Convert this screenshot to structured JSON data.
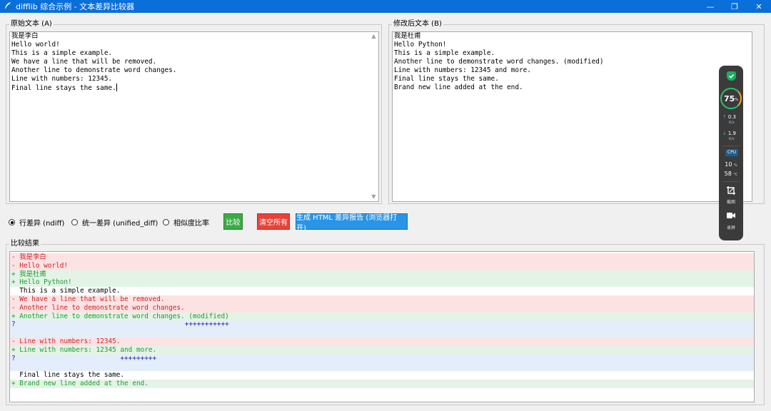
{
  "window": {
    "title": "difflib 综合示例 - 文本差异比较器",
    "app_icon": "feather-icon",
    "minimize_glyph": "—",
    "maximize_glyph": "❐",
    "close_glyph": "✕"
  },
  "panel_a": {
    "label": "原始文本 (A)",
    "lines": [
      "我是李白",
      "Hello world!",
      "This is a simple example.",
      "We have a line that will be removed.",
      "Another line to demonstrate word changes.",
      "Line with numbers: 12345.",
      "Final line stays the same."
    ]
  },
  "panel_b": {
    "label": "修改后文本 (B)",
    "lines": [
      "我是杜甫",
      "Hello Python!",
      "This is a simple example.",
      "Another line to demonstrate word changes. (modified)",
      "Line with numbers: 12345 and more.",
      "Final line stays the same.",
      "Brand new line added at the end."
    ]
  },
  "controls": {
    "radio_ndiff": "行差异 (ndiff)",
    "radio_unified": "统一差异 (unified_diff)",
    "radio_ratio": "相似度比率",
    "selected": "ndiff",
    "compare_button": "比较",
    "clear_button": "清空所有",
    "html_report_button": "生成 HTML 差异报告 (浏览器打开)"
  },
  "result": {
    "label": "比较结果",
    "lines": [
      {
        "text": "- 我是李白",
        "kind": "del"
      },
      {
        "text": "- Hello world!",
        "kind": "del"
      },
      {
        "text": "+ 我是杜甫",
        "kind": "add"
      },
      {
        "text": "+ Hello Python!",
        "kind": "add"
      },
      {
        "text": "  This is a simple example.",
        "kind": "plain"
      },
      {
        "text": "- We have a line that will be removed.",
        "kind": "del"
      },
      {
        "text": "- Another line to demonstrate word changes.",
        "kind": "del"
      },
      {
        "text": "+ Another line to demonstrate word changes. (modified)",
        "kind": "add"
      },
      {
        "text": "?                                          +++++++++++",
        "kind": "info"
      },
      {
        "text": "",
        "kind": "info"
      },
      {
        "text": "- Line with numbers: 12345.",
        "kind": "del"
      },
      {
        "text": "+ Line with numbers: 12345 and more.",
        "kind": "add"
      },
      {
        "text": "?                          +++++++++",
        "kind": "info"
      },
      {
        "text": "",
        "kind": "info"
      },
      {
        "text": "  Final line stays the same.",
        "kind": "plain"
      },
      {
        "text": "+ Brand new line added at the end.",
        "kind": "add"
      }
    ]
  },
  "colors": {
    "titlebar": "#0a6fd8",
    "compare_button": "#3cab46",
    "clear_button": "#e8423a",
    "html_report_button": "#2a95e6"
  },
  "monitor_widget": {
    "shield_icon": "shield-check-icon",
    "score": "75",
    "score_unit": "%",
    "upload_value": "0.3",
    "upload_unit": "K/s",
    "download_value": "1.9",
    "download_unit": "K/s",
    "cpu_label": "CPU",
    "cpu_usage": "10",
    "cpu_usage_unit": "%",
    "cpu_temp": "58",
    "cpu_temp_unit": "°C",
    "screenshot_label": "截图",
    "record_label": "录屏"
  }
}
